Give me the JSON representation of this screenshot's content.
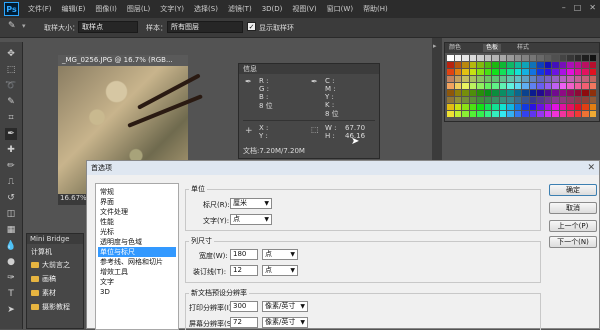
{
  "app": {
    "logo": "Ps"
  },
  "menubar": {
    "items": [
      "文件(F)",
      "编辑(E)",
      "图像(I)",
      "图层(L)",
      "文字(Y)",
      "选择(S)",
      "滤镜(T)",
      "3D(D)",
      "视图(V)",
      "窗口(W)",
      "帮助(H)"
    ],
    "window_controls": [
      "–",
      "□",
      "✕"
    ]
  },
  "options": {
    "sample_size_label": "取样大小：",
    "sample_size_value": "取样点",
    "sample_label": "样本：",
    "sample_value": "所有图层",
    "show_ring_label": "显示取样环",
    "show_ring_checked": "✓"
  },
  "document": {
    "tab_title": "_MG_0256.JPG @ 16.7% (RGB...",
    "zoom": "16.67%"
  },
  "info_panel": {
    "tab": "信息",
    "rows_left": [
      "R :",
      "G :",
      "B :",
      "8 位"
    ],
    "rows_right": [
      "C :",
      "M :",
      "Y :",
      "K :",
      "8 位"
    ],
    "xy_labels": [
      "X :",
      "Y :"
    ],
    "wh_labels": [
      "W :",
      "H :"
    ],
    "w_value": "67.70",
    "h_value": "46.16",
    "doc_label": "文档:7.20M/7.20M"
  },
  "swatches": {
    "tabs": [
      "颜色",
      "色板",
      "样式"
    ],
    "active_tab": "色板"
  },
  "mini_bridge": {
    "tab": "Mini Bridge",
    "header": "计算机",
    "items": [
      "大前言之",
      "画稿",
      "素材",
      "摄影教程"
    ]
  },
  "dialog": {
    "title": "首选项",
    "close": "✕",
    "categories": [
      "常规",
      "界面",
      "文件处理",
      "性能",
      "光标",
      "透明度与色域",
      "单位与标尺",
      "参考线、网格和切片",
      "增效工具",
      "文字",
      "3D"
    ],
    "selected": "单位与标尺",
    "units_group": "单位",
    "ruler_label": "标尺(R):",
    "ruler_value": "厘米",
    "type_label": "文字(Y):",
    "type_value": "点",
    "column_group": "列尺寸",
    "width_label": "宽度(W):",
    "width_value": "180",
    "width_unit": "点",
    "gutter_label": "装订线(T):",
    "gutter_value": "12",
    "gutter_unit": "点",
    "newdoc_group": "新文档预设分辨率",
    "print_label": "打印分辨率(I):",
    "print_value": "300",
    "print_unit": "像素/英寸",
    "screen_label": "屏幕分辨率(S):",
    "screen_value": "72",
    "screen_unit": "像素/英寸",
    "buttons": [
      "确定",
      "取消",
      "上一个(P)",
      "下一个(N)"
    ]
  }
}
